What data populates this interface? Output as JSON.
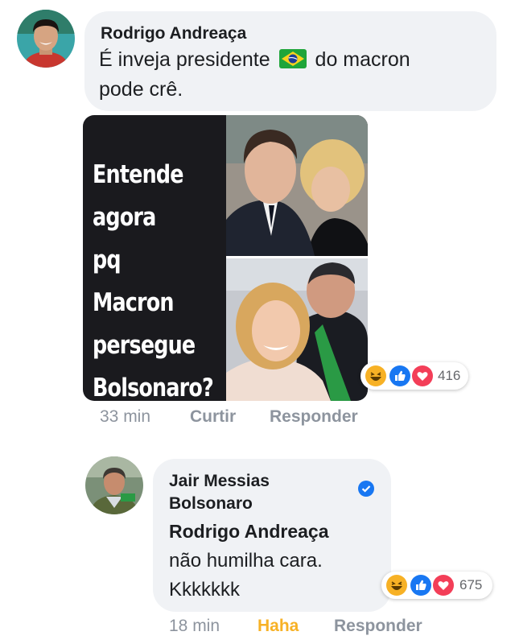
{
  "comment1": {
    "author": "Rodrigo Andreaça",
    "text_line1_before_flag": "É inveja presidente",
    "flag_emoji": "🇧🇷",
    "text_line1_after_flag": "do macron",
    "text_line2": "pode crê.",
    "meme_text": "Entende\nagora\npq Macron\npersegue\nBolsonaro?",
    "reaction_count": "416",
    "reaction_icons": [
      "haha-icon",
      "like-icon",
      "love-icon"
    ],
    "time": "33 min",
    "like_label": "Curtir",
    "reply_label": "Responder"
  },
  "comment2": {
    "author_line1": "Jair Messias",
    "author_line2": "Bolsonaro",
    "verified": true,
    "mention": "Rodrigo Andreaça",
    "text_line1": "não humilha cara.",
    "text_line2": "Kkkkkkk",
    "reaction_count": "675",
    "reaction_icons": [
      "haha-icon",
      "like-icon",
      "love-icon"
    ],
    "time": "18 min",
    "reaction_label": "Haha",
    "reply_label": "Responder"
  },
  "colors": {
    "bubble": "#f0f2f5",
    "text": "#1c1e21",
    "muted": "#8d949e",
    "haha": "#f7b125",
    "like": "#1877f2",
    "love": "#f33e58",
    "verified": "#1877f2"
  }
}
